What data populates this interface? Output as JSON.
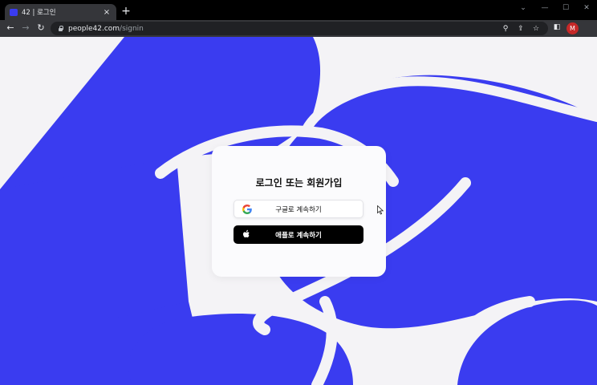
{
  "browser": {
    "tab_title": "42 | 로그인",
    "tab_close": "×",
    "new_tab": "+",
    "url_host": "people42.com",
    "url_path": "/signin",
    "profile_initial": "M",
    "window_controls": [
      "chevron-down",
      "minimize",
      "maximize",
      "close"
    ],
    "nav_icons": [
      "back-arrow",
      "forward-arrow",
      "reload"
    ],
    "toolbar_icons": [
      "location-pin",
      "share",
      "star",
      "side-panel"
    ]
  },
  "page": {
    "accent_color": "#3a3cf0",
    "background_color": "#f4f3f6",
    "card": {
      "title": "로그인 또는 회원가입",
      "google_button": {
        "label": "구글로 계속하기",
        "icon": "google-icon"
      },
      "apple_button": {
        "label": "애플로 계속하기",
        "icon": "apple-icon"
      }
    }
  }
}
